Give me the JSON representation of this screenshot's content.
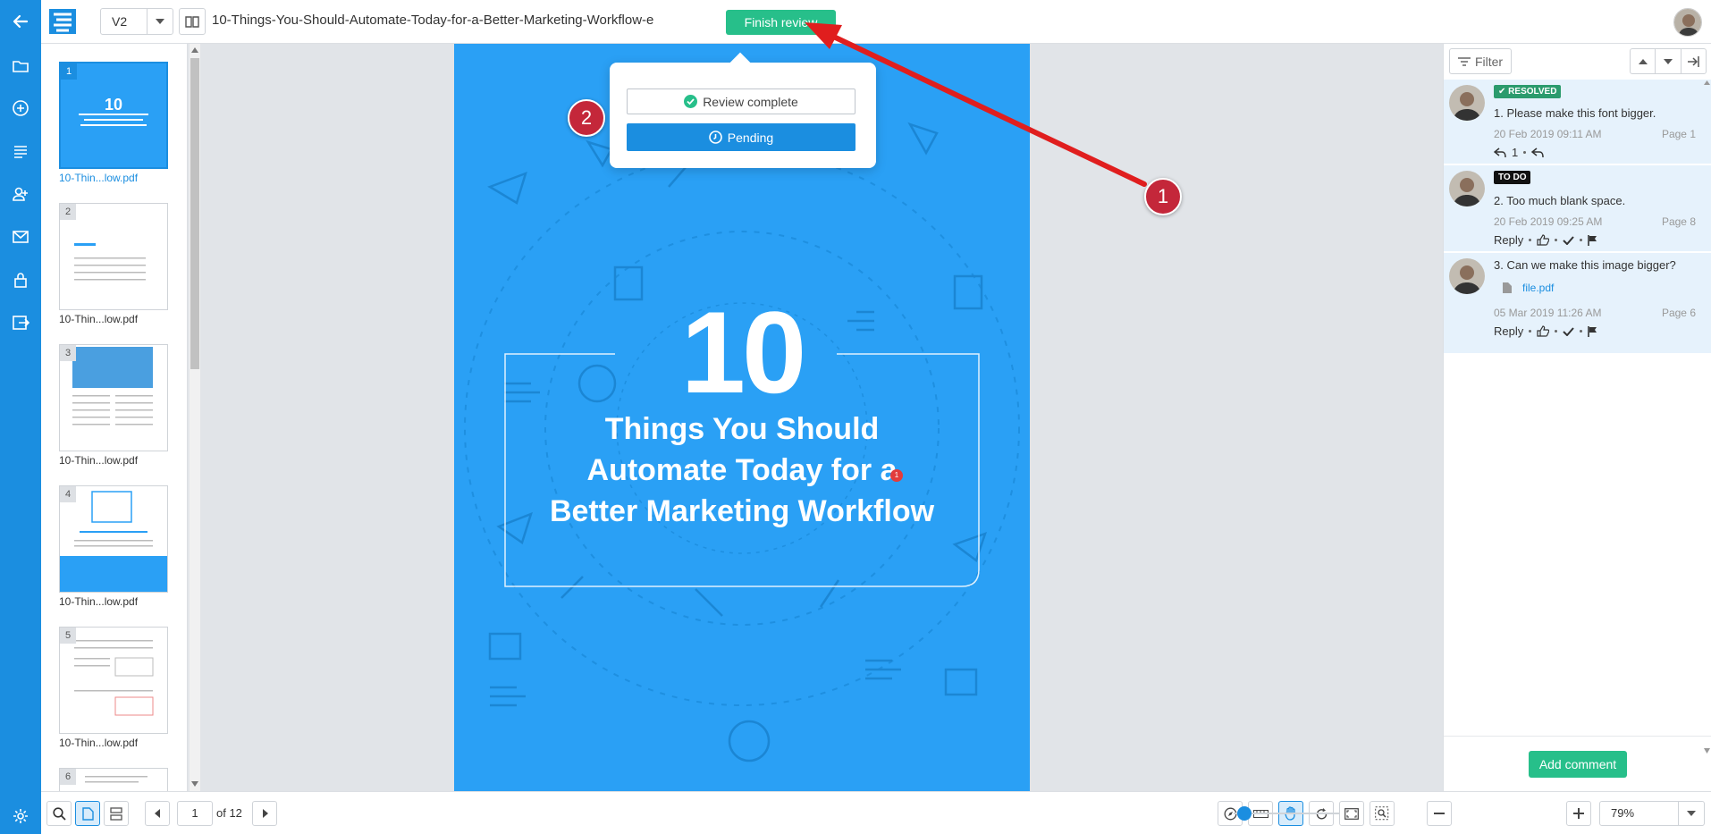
{
  "colors": {
    "brand": "#1b8ee0",
    "accent_green": "#27bf8a",
    "page_blue": "#2aa0f5",
    "callout_red": "#c4273a",
    "arrow_red": "#e01e1e"
  },
  "rail": {
    "icons": [
      "back-arrow-icon",
      "folder-icon",
      "add-circle-icon",
      "list-icon",
      "add-user-icon",
      "mail-icon",
      "lock-icon",
      "export-icon",
      "settings-icon"
    ]
  },
  "header": {
    "version": "V2",
    "document_title": "10-Things-You-Should-Automate-Today-for-a-Better-Marketing-Workflow-e",
    "finish_review_label": "Finish review"
  },
  "review_popup": {
    "review_complete_label": "Review complete",
    "pending_label": "Pending"
  },
  "callouts": {
    "one": "1",
    "two": "2"
  },
  "thumbnails": [
    {
      "number": "1",
      "label": "10-Thin...low.pdf",
      "active": true
    },
    {
      "number": "2",
      "label": "10-Thin...low.pdf",
      "active": false
    },
    {
      "number": "3",
      "label": "10-Thin...low.pdf",
      "active": false
    },
    {
      "number": "4",
      "label": "10-Thin...low.pdf",
      "active": false
    },
    {
      "number": "5",
      "label": "10-Thin...low.pdf",
      "active": false
    },
    {
      "number": "6",
      "label": "",
      "active": false
    }
  ],
  "page_content": {
    "big_number": "10",
    "title_line1": "Things You Should",
    "title_line2": "Automate Today for a",
    "title_line3": "Better Marketing Workflow",
    "marker": "1"
  },
  "comments_panel": {
    "filter_label": "Filter",
    "add_comment_label": "Add comment",
    "comments": [
      {
        "badge": "RESOLVED",
        "text": "1.  Please make this font bigger.",
        "date": "20 Feb 2019 09:11 AM",
        "page": "Page 1",
        "reply_count": "1"
      },
      {
        "badge": "TO DO",
        "text": "2.  Too much blank space.",
        "date": "20 Feb 2019 09:25 AM",
        "page": "Page 8",
        "reply_label": "Reply"
      },
      {
        "text": "3.  Can we make this image bigger?",
        "attachment": "file.pdf",
        "date": "05 Mar 2019 11:26 AM",
        "page": "Page 6",
        "reply_label": "Reply"
      }
    ]
  },
  "footer": {
    "current_page": "1",
    "page_of": "of 12",
    "zoom": "79%",
    "zoom_fraction": 0.1
  }
}
